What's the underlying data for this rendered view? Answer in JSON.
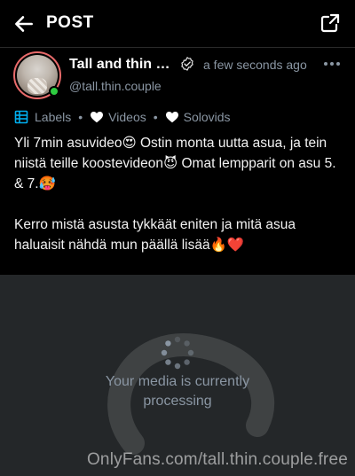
{
  "header": {
    "title": "POST",
    "back_icon": "arrow-left-icon",
    "share_icon": "share-icon"
  },
  "author": {
    "name": "Tall and thin c...",
    "handle": "@tall.thin.couple",
    "time": "a few seconds ago",
    "verified": true,
    "online": true,
    "ring_color": "#e86a6a",
    "online_color": "#2ecc40"
  },
  "labels": {
    "labels_text": "Labels",
    "items": [
      {
        "icon": "heart-icon",
        "text": "Videos"
      },
      {
        "icon": "heart-icon",
        "text": "Solovids"
      }
    ]
  },
  "post": {
    "paragraph1": "Yli 7min asuvideo😍 Ostin monta uutta asua, ja tein niistä teille koostevideon😈 Omat lempparit on asu 5. & 7.🥵",
    "paragraph2": "Kerro mistä asusta tykkäät eniten ja mitä asua haluaisit nähdä mun päällä lisää🔥❤️"
  },
  "media": {
    "status": "Your media is currently processing",
    "watermark": "OnlyFans.com/tall.thin.couple.free",
    "background_color": "#242729"
  },
  "colors": {
    "muted": "#8a96a3",
    "accent": "#00aff0"
  }
}
